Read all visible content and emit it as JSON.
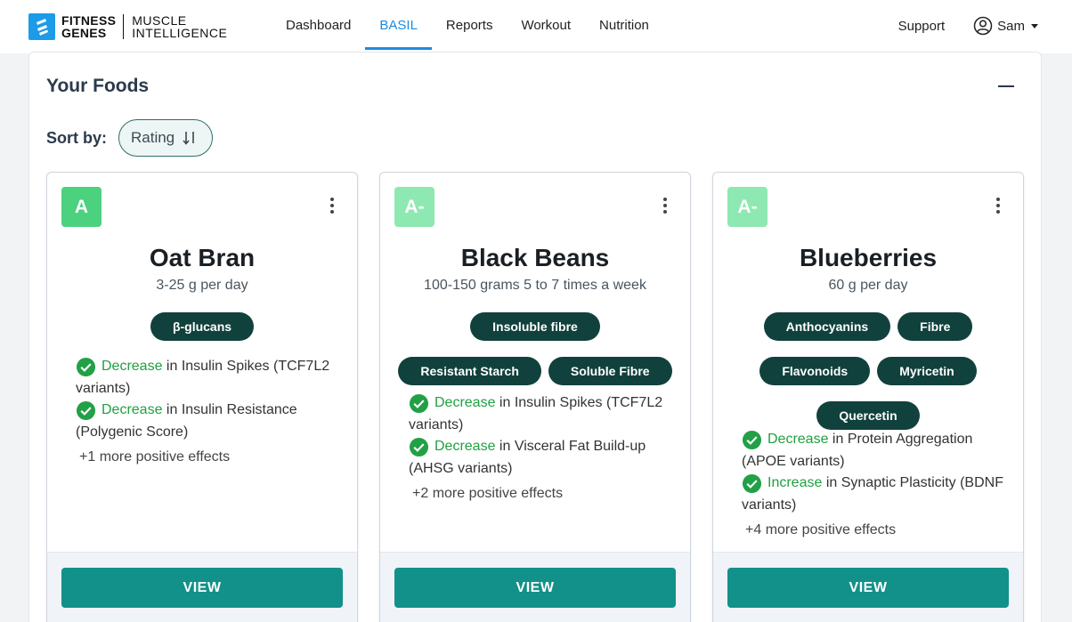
{
  "nav": {
    "logo_left": "FITNESS GENES",
    "logo_left_line1": "FITNESS",
    "logo_left_line2": "GENES",
    "logo_right_line1": "MUSCLE",
    "logo_right_line2": "INTELLIGENCE",
    "links": [
      "Dashboard",
      "BASIL",
      "Reports",
      "Workout",
      "Nutrition"
    ],
    "active": "BASIL",
    "support": "Support",
    "user": "Sam"
  },
  "panel": {
    "title": "Your Foods",
    "sort_label": "Sort by:",
    "sort_value": "Rating"
  },
  "colors": {
    "brand_blue": "#1c8be0",
    "grade_a": "#4cd17f",
    "grade_a_minus": "#8ee8b1",
    "tag_bg": "#11413d",
    "view_btn": "#12918a",
    "effect_green": "#21a041"
  },
  "cards": [
    {
      "grade": "A",
      "grade_color": "#4cd17f",
      "name": "Oat Bran",
      "dose": "3-25 g per day",
      "tags": [
        "β-glucans"
      ],
      "effects": [
        {
          "verb": "Decrease",
          "text": " in Insulin Spikes (TCF7L2 variants)"
        },
        {
          "verb": "Decrease",
          "text": " in Insulin Resistance (Polygenic Score)"
        }
      ],
      "more": "+1 more positive effects",
      "view": "VIEW"
    },
    {
      "grade": "A-",
      "grade_color": "#8ee8b1",
      "name": "Black Beans",
      "dose": "100-150 grams 5 to 7 times a week",
      "tags": [
        "Insoluble fibre",
        "Resistant Starch",
        "Soluble Fibre"
      ],
      "effects": [
        {
          "verb": "Decrease",
          "text": " in Insulin Spikes (TCF7L2 variants)"
        },
        {
          "verb": "Decrease",
          "text": " in Visceral Fat Build-up (AHSG variants)"
        }
      ],
      "more": "+2 more positive effects",
      "view": "VIEW"
    },
    {
      "grade": "A-",
      "grade_color": "#8ee8b1",
      "name": "Blueberries",
      "dose": "60 g per day",
      "tags": [
        "Anthocyanins",
        "Fibre",
        "Flavonoids",
        "Myricetin",
        "Quercetin"
      ],
      "effects": [
        {
          "verb": "Decrease",
          "text": " in Protein Aggregation (APOE variants)"
        },
        {
          "verb": "Increase",
          "text": " in Synaptic Plasticity (BDNF variants)"
        }
      ],
      "more": "+4 more positive effects",
      "view": "VIEW"
    }
  ]
}
